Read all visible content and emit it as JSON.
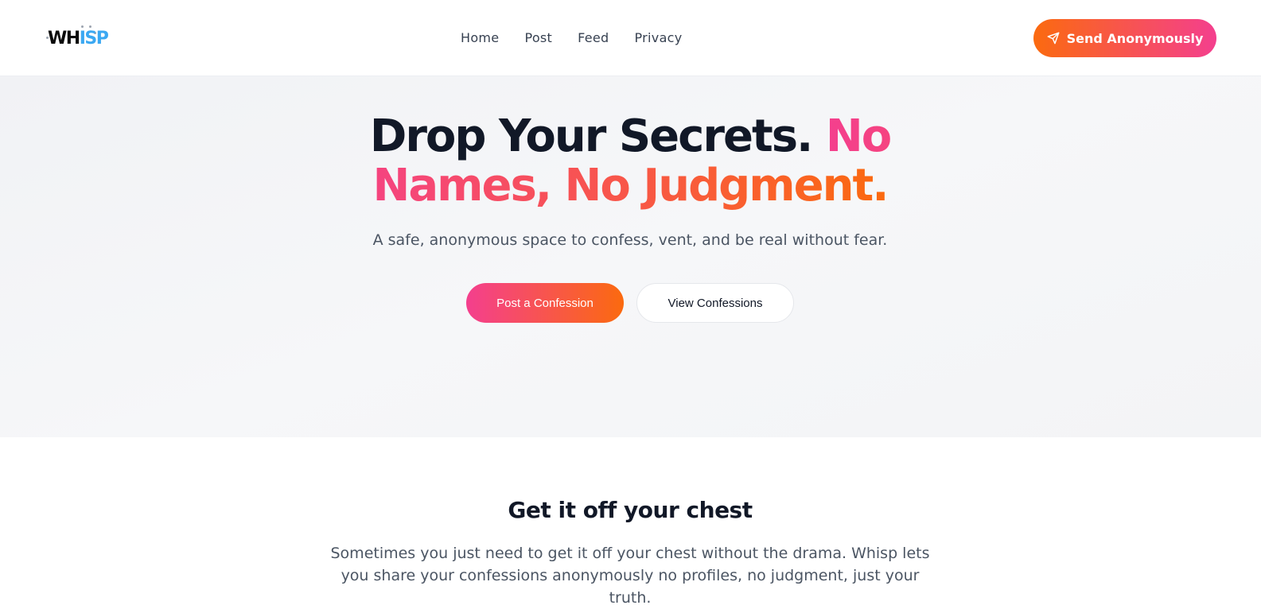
{
  "navbar": {
    "logo": {
      "part1": "WH",
      "part2": "ISP"
    },
    "links": [
      "Home",
      "Post",
      "Feed",
      "Privacy"
    ],
    "cta_label": "Send Anonymously"
  },
  "hero": {
    "title_plain": "Drop Your Secrets. ",
    "title_accent": "No Names, No Judgment.",
    "subtitle": "A safe, anonymous space to confess, vent, and be real without fear.",
    "primary_button": "Post a Confession",
    "secondary_button": "View Confessions"
  },
  "section": {
    "title": "Get it off your chest",
    "body": "Sometimes you just need to get it off your chest without the drama. Whisp lets you share your confessions anonymously no profiles, no judgment, just your truth."
  },
  "colors": {
    "gradient_start": "#f43f8e",
    "gradient_end": "#fb6a0f",
    "logo_blue": "#3ba8f2",
    "text_dark": "#111827"
  },
  "icons": {
    "cta_icon": "send-icon"
  }
}
